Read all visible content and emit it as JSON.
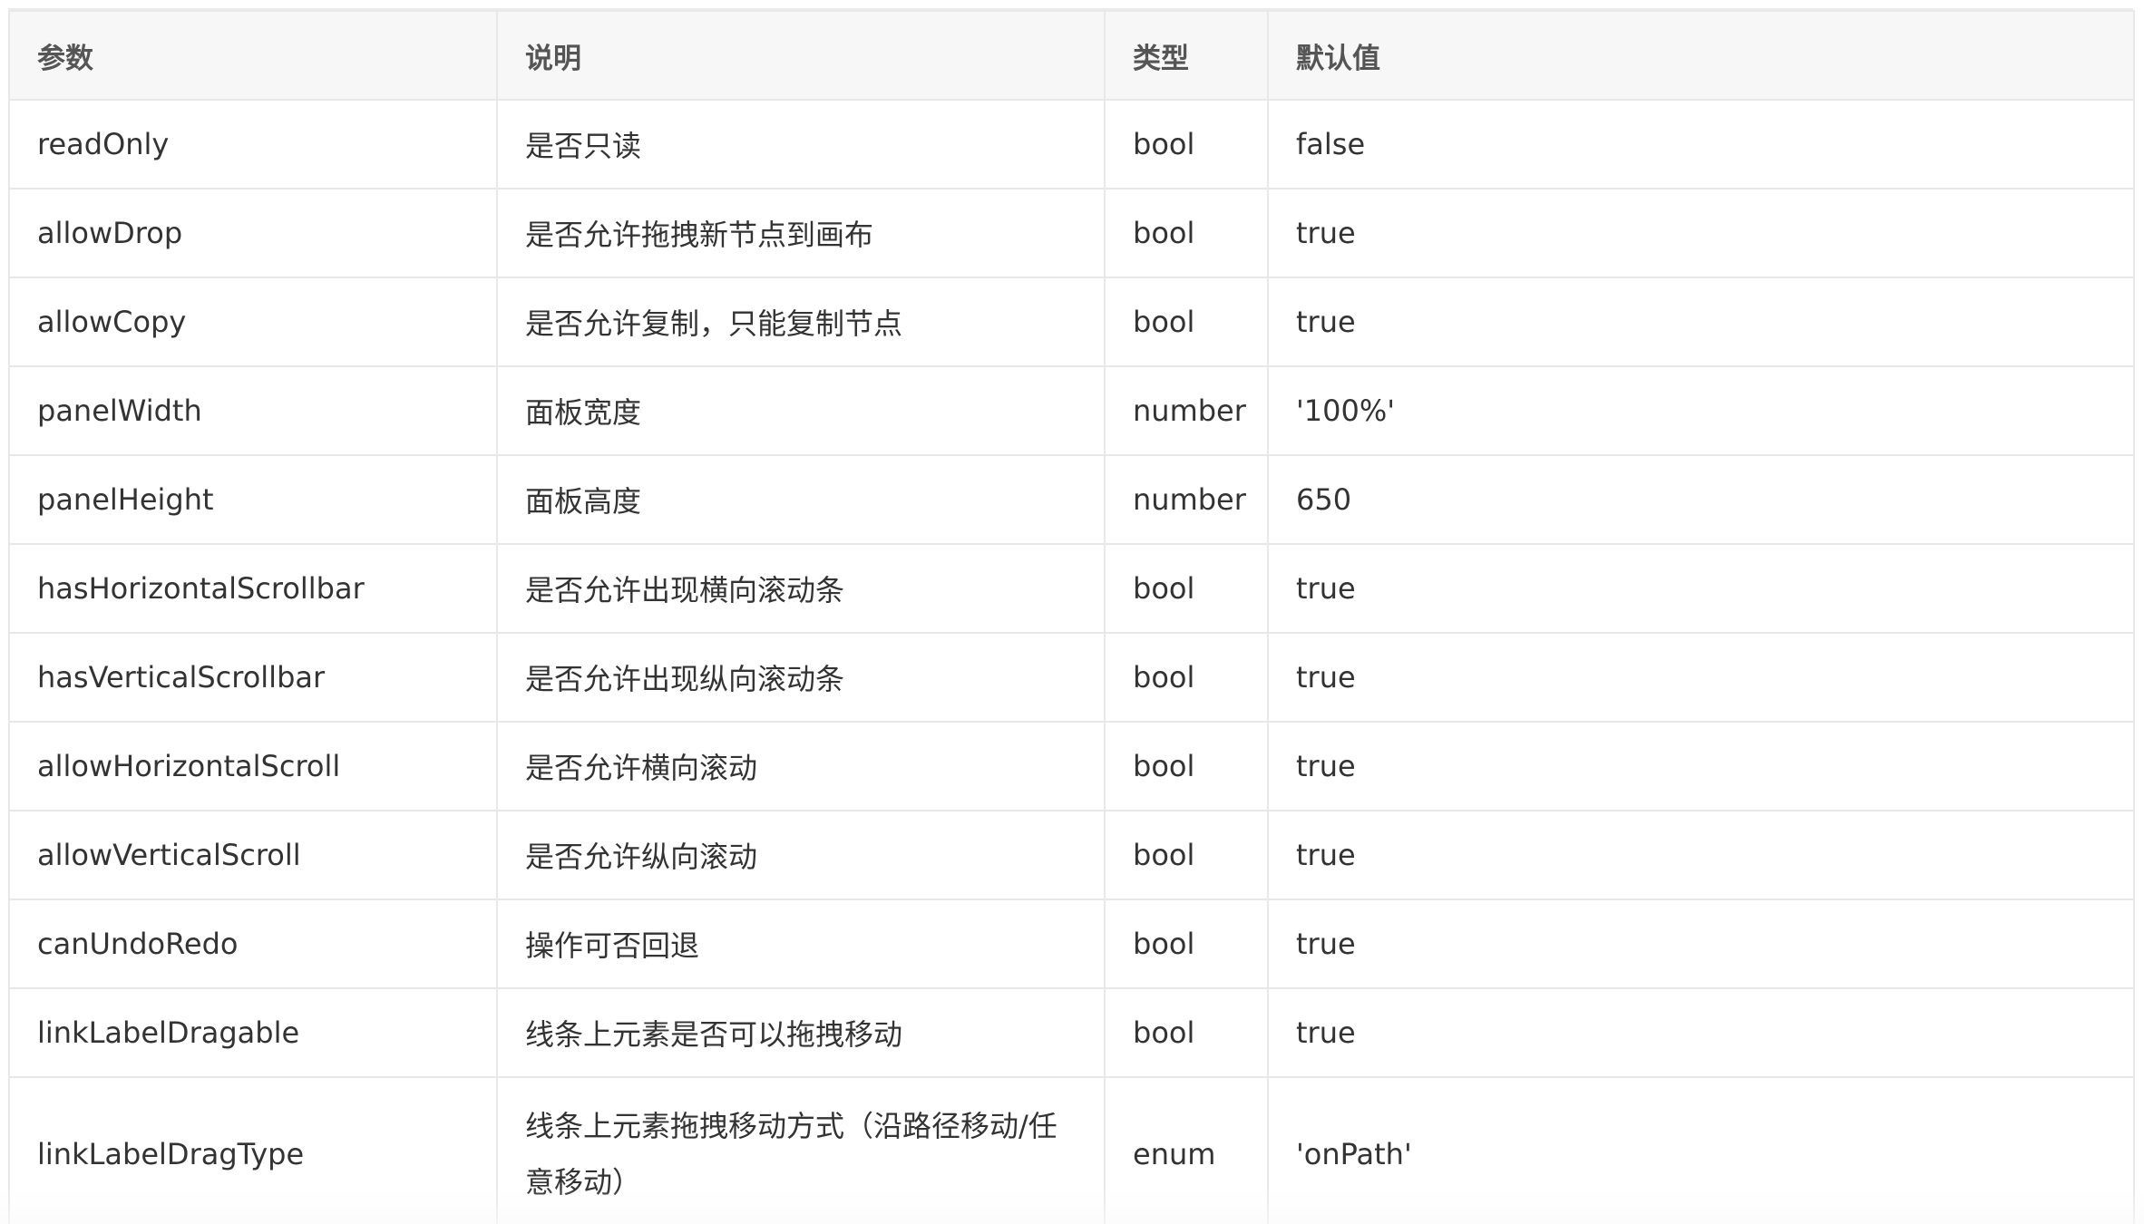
{
  "table": {
    "headers": [
      "参数",
      "说明",
      "类型",
      "默认值"
    ],
    "rows": [
      [
        "readOnly",
        "是否只读",
        "bool",
        "false"
      ],
      [
        "allowDrop",
        "是否允许拖拽新节点到画布",
        "bool",
        "true"
      ],
      [
        "allowCopy",
        "是否允许复制，只能复制节点",
        "bool",
        "true"
      ],
      [
        "panelWidth",
        "面板宽度",
        "number",
        "'100%'"
      ],
      [
        "panelHeight",
        "面板高度",
        "number",
        "650"
      ],
      [
        "hasHorizontalScrollbar",
        "是否允许出现横向滚动条",
        "bool",
        "true"
      ],
      [
        "hasVerticalScrollbar",
        "是否允许出现纵向滚动条",
        "bool",
        "true"
      ],
      [
        "allowHorizontalScroll",
        "是否允许横向滚动",
        "bool",
        "true"
      ],
      [
        "allowVerticalScroll",
        "是否允许纵向滚动",
        "bool",
        "true"
      ],
      [
        "canUndoRedo",
        "操作可否回退",
        "bool",
        "true"
      ],
      [
        "linkLabelDragable",
        "线条上元素是否可以拖拽移动",
        "bool",
        "true"
      ],
      [
        "linkLabelDragType",
        "线条上元素拖拽移动方式（沿路径移动/任意移动）",
        "enum",
        "'onPath'"
      ]
    ]
  }
}
